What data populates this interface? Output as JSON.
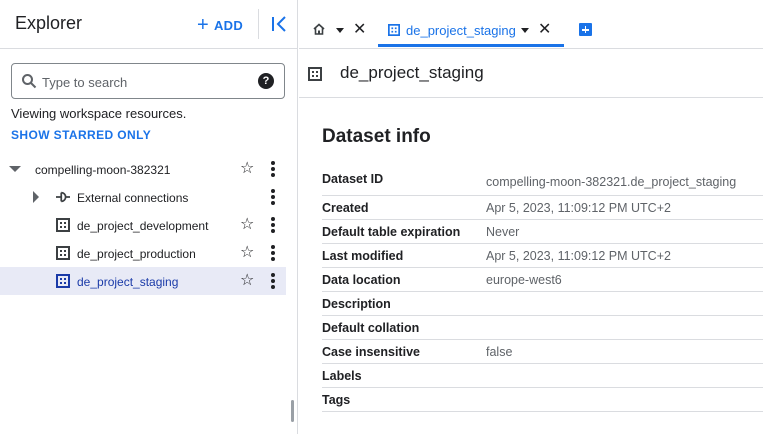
{
  "explorer": {
    "title": "Explorer",
    "add_label": "ADD",
    "search": {
      "placeholder": "Type to search",
      "value": ""
    },
    "viewing_text": "Viewing workspace resources.",
    "show_starred_label": "SHOW STARRED ONLY",
    "project": "compelling-moon-382321",
    "items": [
      {
        "label": "External connections",
        "icon": "external-connection-icon"
      },
      {
        "label": "de_project_development",
        "icon": "dataset-icon"
      },
      {
        "label": "de_project_production",
        "icon": "dataset-icon"
      },
      {
        "label": "de_project_staging",
        "icon": "dataset-icon",
        "selected": true
      }
    ]
  },
  "tabs": {
    "home_icon": "home-icon",
    "active_label": "de_project_staging"
  },
  "dataset": {
    "title": "de_project_staging",
    "info_title": "Dataset info",
    "rows": [
      {
        "key": "Dataset ID",
        "value": "compelling-moon-382321.de_project_staging"
      },
      {
        "key": "Created",
        "value": "Apr 5, 2023, 11:09:12 PM UTC+2"
      },
      {
        "key": "Default table expiration",
        "value": "Never"
      },
      {
        "key": "Last modified",
        "value": "Apr 5, 2023, 11:09:12 PM UTC+2"
      },
      {
        "key": "Data location",
        "value": "europe-west6"
      },
      {
        "key": "Description",
        "value": ""
      },
      {
        "key": "Default collation",
        "value": ""
      },
      {
        "key": "Case insensitive",
        "value": "false"
      },
      {
        "key": "Labels",
        "value": ""
      },
      {
        "key": "Tags",
        "value": ""
      }
    ]
  },
  "colors": {
    "accent": "#1a73e8",
    "selected_bg": "#e8eaf6",
    "divider": "#dadce0"
  }
}
